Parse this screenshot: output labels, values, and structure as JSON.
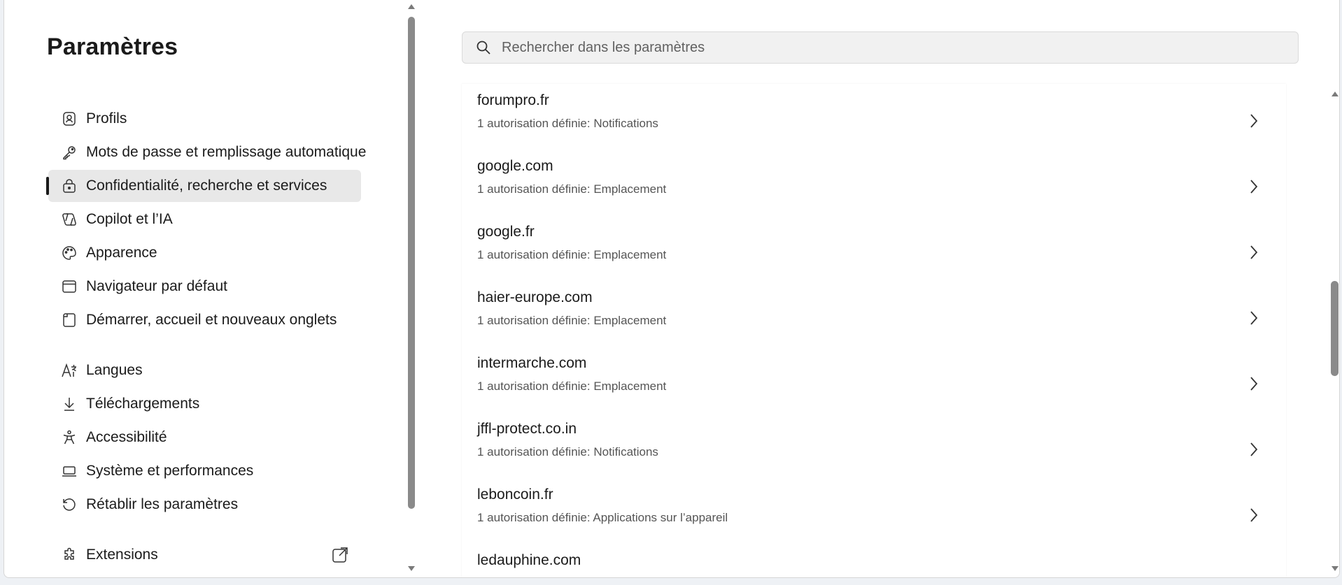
{
  "sidebar": {
    "title": "Paramètres",
    "items": [
      {
        "label": "Profils",
        "icon": "profile-icon"
      },
      {
        "label": "Mots de passe et remplissage automatique",
        "icon": "key-icon"
      },
      {
        "label": "Confidentialité, recherche et services",
        "icon": "lock-icon",
        "active": true
      },
      {
        "label": "Copilot et l’IA",
        "icon": "copilot-icon"
      },
      {
        "label": "Apparence",
        "icon": "palette-icon"
      },
      {
        "label": "Navigateur par défaut",
        "icon": "browser-icon"
      },
      {
        "label": "Démarrer, accueil et nouveaux onglets",
        "icon": "home-tab-icon"
      },
      {
        "label": "Langues",
        "icon": "language-icon"
      },
      {
        "label": "Téléchargements",
        "icon": "download-icon"
      },
      {
        "label": "Accessibilité",
        "icon": "accessibility-icon"
      },
      {
        "label": "Système et performances",
        "icon": "laptop-icon"
      },
      {
        "label": "Rétablir les paramètres",
        "icon": "reset-icon"
      },
      {
        "label": "Extensions",
        "icon": "puzzle-icon"
      }
    ]
  },
  "search": {
    "placeholder": "Rechercher dans les paramètres"
  },
  "sites": [
    {
      "name": "forumpro.fr",
      "desc": "1 autorisation définie: Notifications"
    },
    {
      "name": "google.com",
      "desc": "1 autorisation définie: Emplacement"
    },
    {
      "name": "google.fr",
      "desc": "1 autorisation définie: Emplacement"
    },
    {
      "name": "haier-europe.com",
      "desc": "1 autorisation définie: Emplacement"
    },
    {
      "name": "intermarche.com",
      "desc": "1 autorisation définie: Emplacement"
    },
    {
      "name": "jffl-protect.co.in",
      "desc": "1 autorisation définie: Notifications"
    },
    {
      "name": "leboncoin.fr",
      "desc": "1 autorisation définie: Applications sur l’appareil"
    },
    {
      "name": "ledauphine.com",
      "desc": ""
    }
  ],
  "colors": {
    "accent": "#1a1a1a",
    "active_bg": "#e8e8e8",
    "window_bg": "#ffffff"
  }
}
